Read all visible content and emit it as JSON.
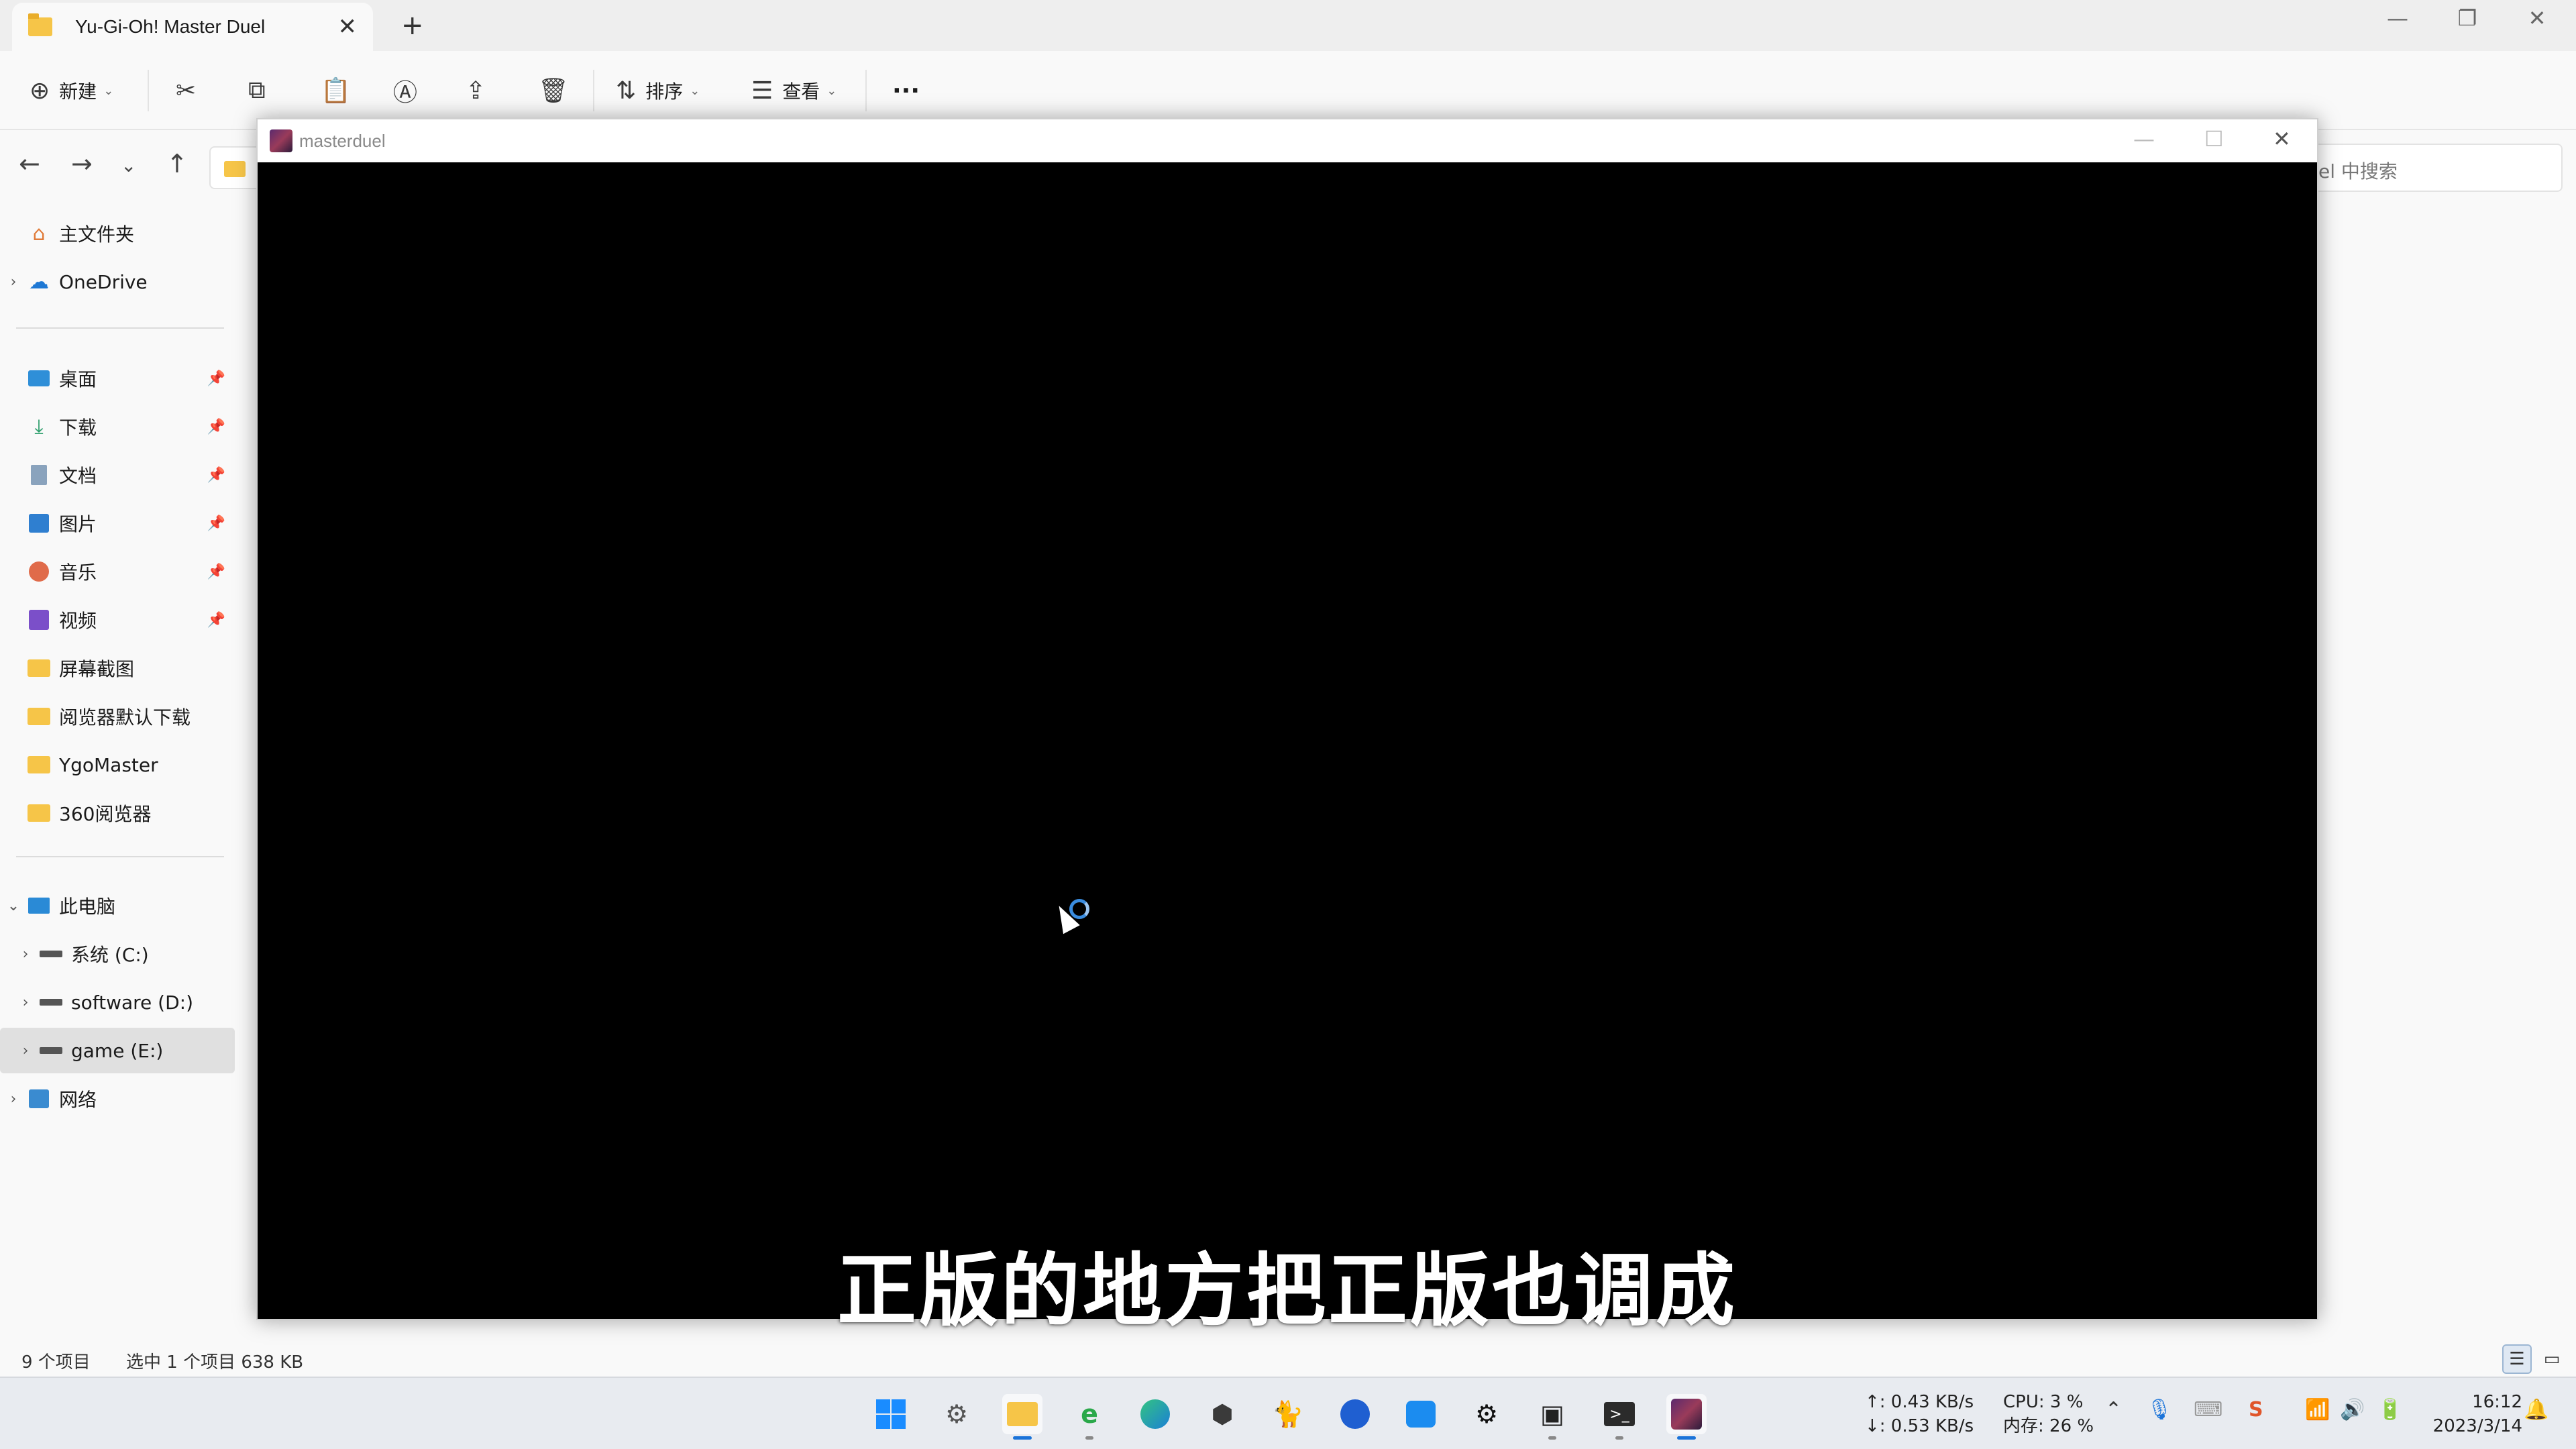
{
  "explorer": {
    "tab_title": "Yu-Gi-Oh!  Master Duel",
    "tab_close": "✕",
    "new_tab": "+",
    "win_min": "—",
    "win_max": "❐",
    "win_close": "✕",
    "toolbar": {
      "new_label": "新建",
      "sort_label": "排序",
      "view_label": "查看",
      "more_label": "···"
    },
    "search_placeholder": "el 中搜索",
    "sidebar": {
      "home": "主文件夹",
      "onedrive": "OneDrive",
      "desktop": "桌面",
      "downloads": "下载",
      "documents": "文档",
      "pictures": "图片",
      "music": "音乐",
      "videos": "视频",
      "screenshots": "屏幕截图",
      "browser_downloads": "阅览器默认下载",
      "ygomaster": "YgoMaster",
      "browser360": "360阅览器",
      "this_pc": "此电脑",
      "drive_c": "系统 (C:)",
      "drive_d": "software (D:)",
      "drive_e": "game (E:)",
      "network": "网络"
    },
    "status": {
      "item_count": "9 个项目",
      "selected": "选中 1 个项目  638 KB"
    }
  },
  "game": {
    "title": "masterduel",
    "subtitle": "正版的地方把正版也调成"
  },
  "taskbar": {
    "net_up": "↑: 0.43 KB/s",
    "net_down": "↓: 0.53 KB/s",
    "cpu": "CPU: 3 %",
    "mem": "内存: 26 %",
    "time": "16:12",
    "date": "2023/3/14"
  }
}
